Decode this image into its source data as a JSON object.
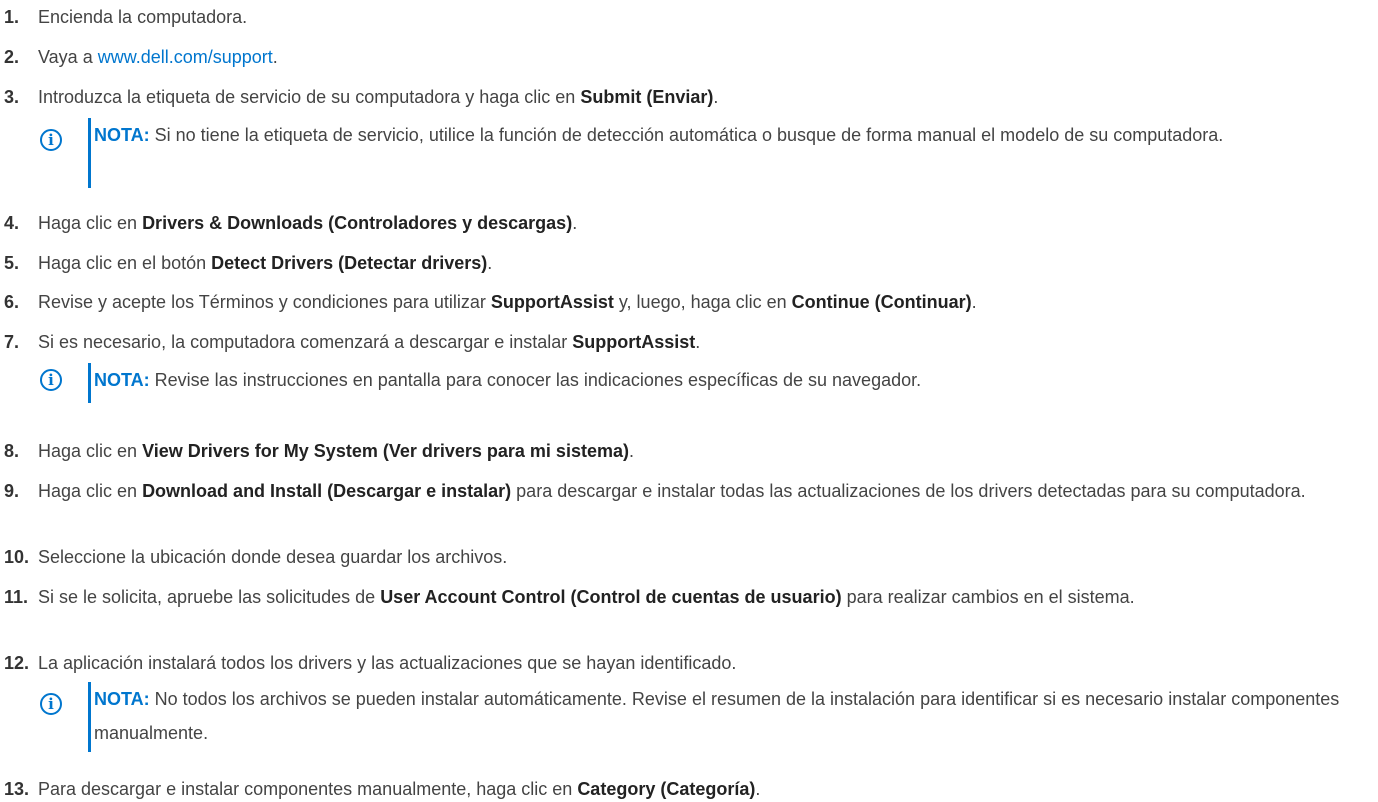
{
  "steps": [
    {
      "num": "1.",
      "parts": [
        "Encienda la computadora."
      ]
    },
    {
      "num": "2.",
      "pre": "Vaya a ",
      "link": "www.dell.com/support",
      "post": "."
    },
    {
      "num": "3.",
      "pre": "Introduzca la etiqueta de servicio de su computadora y haga clic en ",
      "b1": "Submit (Enviar)",
      "post": "."
    },
    {
      "num": "4.",
      "pre": "Haga clic en ",
      "b1": "Drivers & Downloads (Controladores y descargas)",
      "post": "."
    },
    {
      "num": "5.",
      "pre": "Haga clic en el botón ",
      "b1": "Detect Drivers (Detectar drivers)",
      "post": "."
    },
    {
      "num": "6.",
      "pre": "Revise y acepte los Términos y condiciones para utilizar ",
      "b1": "SupportAssist",
      "mid": " y, luego, haga clic en ",
      "b2": "Continue (Continuar)",
      "post": "."
    },
    {
      "num": "7.",
      "pre": "Si es necesario, la computadora comenzará a descargar e instalar ",
      "b1": "SupportAssist",
      "post": "."
    },
    {
      "num": "8.",
      "pre": "Haga clic en ",
      "b1": "View Drivers for My System (Ver drivers para mi sistema)",
      "post": "."
    },
    {
      "num": "9.",
      "pre": "Haga clic en ",
      "b1": "Download and Install (Descargar e instalar)",
      "post": " para descargar e instalar todas las actualizaciones de los drivers detectadas para su computadora."
    },
    {
      "num": "10.",
      "pre": "Seleccione la ubicación donde desea guardar los archivos."
    },
    {
      "num": "11.",
      "pre": "Si se le solicita, apruebe las solicitudes de ",
      "b1": "User Account Control (Control de cuentas de usuario)",
      "post": " para realizar cambios en el sistema."
    },
    {
      "num": "12.",
      "pre": "La aplicación instalará todos los drivers y las actualizaciones que se hayan identificado."
    },
    {
      "num": "13.",
      "pre": "Para descargar e instalar componentes manualmente, haga clic en ",
      "b1": "Category (Categoría)",
      "post": "."
    }
  ],
  "notes": [
    {
      "label": "NOTA:",
      "text": " Si no tiene la etiqueta de servicio, utilice la función de detección automática o busque de forma manual el modelo de su computadora."
    },
    {
      "label": "NOTA:",
      "text": " Revise las instrucciones en pantalla para conocer las indicaciones específicas de su navegador."
    },
    {
      "label": "NOTA:",
      "text": " No todos los archivos se pueden instalar automáticamente. Revise el resumen de la instalación para identificar si es necesario instalar componentes manualmente."
    }
  ],
  "note_icon_glyph": "i",
  "colors": {
    "link": "#0076ce",
    "note_accent": "#0076ce",
    "text": "#444444"
  }
}
